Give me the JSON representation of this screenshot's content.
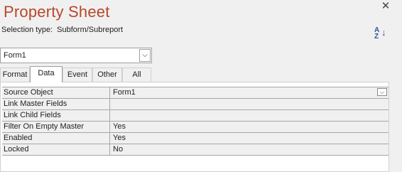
{
  "panel": {
    "title": "Property Sheet",
    "close_icon": "close-icon",
    "selection_type_label": "Selection type:",
    "selection_type_value": "Subform/Subreport",
    "sort_label": "A Z",
    "object_selector": {
      "value": "Form1",
      "dropdown_icon": "chevron-down-icon"
    }
  },
  "tabs": [
    {
      "label": "Format",
      "active": false
    },
    {
      "label": "Data",
      "active": true
    },
    {
      "label": "Event",
      "active": false
    },
    {
      "label": "Other",
      "active": false
    },
    {
      "label": "All",
      "active": false
    }
  ],
  "properties": [
    {
      "name": "Source Object",
      "value": "Form1"
    },
    {
      "name": "Link Master Fields",
      "value": ""
    },
    {
      "name": "Link Child Fields",
      "value": ""
    },
    {
      "name": "Filter On Empty Master",
      "value": "Yes"
    },
    {
      "name": "Enabled",
      "value": "Yes"
    },
    {
      "name": "Locked",
      "value": "No"
    }
  ],
  "colors": {
    "title": "#b7472a",
    "background": "#f0f0f0",
    "grid_line": "#a6a6a6"
  }
}
